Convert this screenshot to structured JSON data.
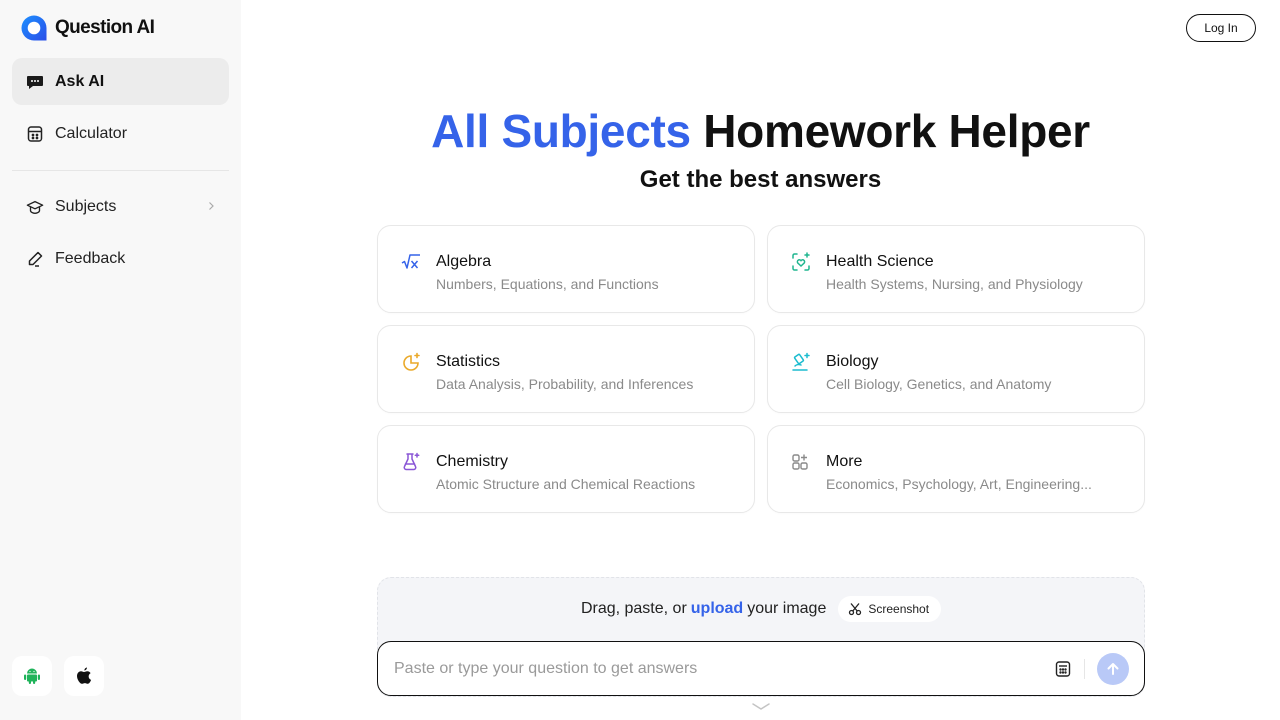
{
  "brand": {
    "name": "Question AI",
    "color": "#3563e9"
  },
  "sidebar": {
    "items": [
      {
        "label": "Ask AI",
        "icon": "chat-bubble-icon",
        "active": true
      },
      {
        "label": "Calculator",
        "icon": "calculator-icon",
        "active": false
      },
      {
        "label": "Subjects",
        "icon": "graduation-cap-icon",
        "active": false,
        "has_submenu": true
      },
      {
        "label": "Feedback",
        "icon": "pencil-icon",
        "active": false
      }
    ],
    "apps": [
      {
        "name": "Android",
        "icon": "android-icon",
        "color": "#1fb35a"
      },
      {
        "name": "iOS",
        "icon": "apple-icon",
        "color": "#111111"
      }
    ]
  },
  "header": {
    "login_label": "Log In"
  },
  "hero": {
    "title_accent": "All Subjects",
    "title_rest": "Homework Helper",
    "subtitle": "Get the best answers"
  },
  "subjects": [
    {
      "title": "Algebra",
      "desc": "Numbers, Equations, and Functions",
      "icon": "square-root-icon",
      "color": "#3563e9"
    },
    {
      "title": "Health Science",
      "desc": "Health Systems, Nursing, and Physiology",
      "icon": "heart-scan-icon",
      "color": "#1fb58f"
    },
    {
      "title": "Statistics",
      "desc": "Data Analysis, Probability, and Inferences",
      "icon": "pie-chart-sparkle-icon",
      "color": "#eaa92a"
    },
    {
      "title": "Biology",
      "desc": "Cell Biology, Genetics, and Anatomy",
      "icon": "microscope-icon",
      "color": "#1bbccf"
    },
    {
      "title": "Chemistry",
      "desc": "Atomic Structure and Chemical Reactions",
      "icon": "flask-icon",
      "color": "#8a56d6"
    },
    {
      "title": "More",
      "desc": "Economics, Psychology, Art, Engineering...",
      "icon": "grid-plus-icon",
      "color": "#8a8a8a"
    }
  ],
  "upload": {
    "prefix": "Drag, paste, or",
    "link": "upload",
    "suffix": "your image",
    "screenshot_label": "Screenshot"
  },
  "question_input": {
    "value": "",
    "placeholder": "Paste or type your question to get answers"
  }
}
